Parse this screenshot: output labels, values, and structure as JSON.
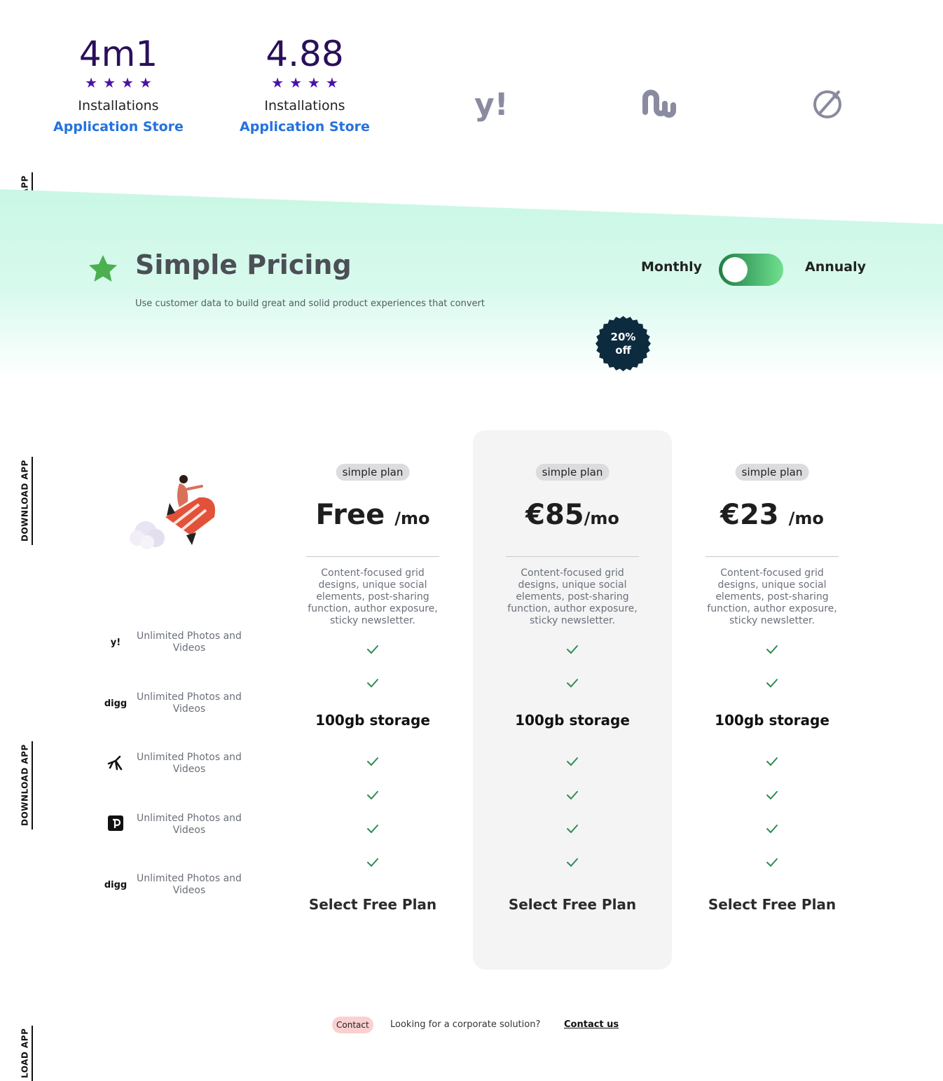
{
  "side_labels": [
    "DOWNLOAD APP",
    "DOWNLOAD APP",
    "DOWNLOAD APP",
    "LOAD APP"
  ],
  "stats": [
    {
      "value": "4m1",
      "stars": "★★★★",
      "label": "Installations",
      "link": "Application Store"
    },
    {
      "value": "4.88",
      "stars": "★★★★",
      "label": "Installations",
      "link": "Application Store"
    }
  ],
  "brand_logos": [
    "yahoo-icon",
    "stumbleupon-icon",
    "compass-icon"
  ],
  "pricing": {
    "title": "Simple Pricing",
    "subtitle": "Use customer data to build great and solid product experiences that convert",
    "toggle": {
      "left": "Monthly",
      "right": "Annualy",
      "state": "monthly"
    },
    "badge": {
      "line1": "20%",
      "line2": "off"
    }
  },
  "features": [
    {
      "logo": "y!",
      "icon": "yahoo-icon",
      "text": "Unlimited Photos and Videos"
    },
    {
      "logo": "digg",
      "icon": "digg-icon",
      "text": "Unlimited Photos and Videos"
    },
    {
      "logo": "",
      "icon": "dancer-icon",
      "text": "Unlimited Photos and Videos"
    },
    {
      "logo": "",
      "icon": "pixel-icon",
      "text": "Unlimited Photos and Videos"
    },
    {
      "logo": "digg",
      "icon": "digg-icon",
      "text": "Unlimited Photos and Videos"
    }
  ],
  "plans": [
    {
      "tag": "simple plan",
      "price": "Free",
      "unit": "/mo",
      "description": "Content-focused grid designs, unique social elements, post-sharing function, author exposure, sticky newsletter.",
      "storage": "100gb storage",
      "cta": "Select Free Plan",
      "featured": false
    },
    {
      "tag": "simple plan",
      "price": "€85",
      "unit": "/mo",
      "description": "Content-focused grid designs, unique social elements, post-sharing function, author exposure, sticky newsletter.",
      "storage": "100gb storage",
      "cta": "Select Free Plan",
      "featured": true
    },
    {
      "tag": "simple plan",
      "price": "€23",
      "unit": "/mo",
      "description": "Content-focused grid designs, unique social elements, post-sharing function, author exposure, sticky newsletter.",
      "storage": "100gb storage",
      "cta": "Select Free Plan",
      "featured": false
    }
  ],
  "footer": {
    "pill": "Contact",
    "text": "Looking for a corporate solution?",
    "link": "Contact us"
  },
  "colors": {
    "stat_value": "#2a0f5c",
    "stars": "#4b12a8",
    "link": "#2472dd",
    "check": "#2e8b57",
    "badge": "#0d2b3e",
    "toggle_start": "#1f7e45",
    "toggle_end": "#6fe08f",
    "band": "#c9f7e5",
    "pill": "#fbd0d0"
  }
}
